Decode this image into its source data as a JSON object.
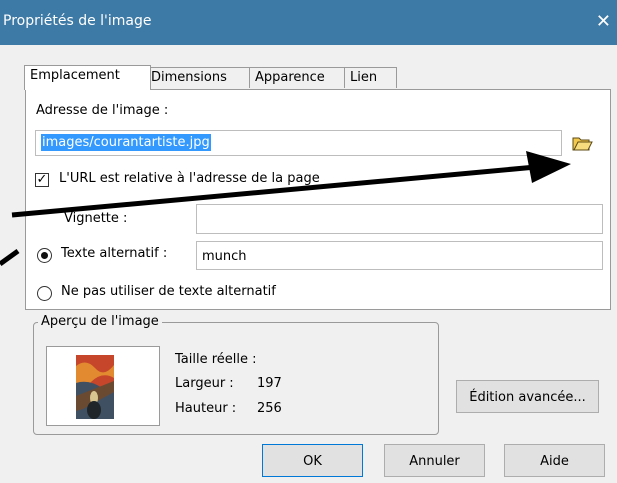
{
  "window": {
    "title": "Propriétés de l'image",
    "close_symbol": "✕"
  },
  "tabs": [
    {
      "label": "Emplacement",
      "active": true
    },
    {
      "label": "Dimensions",
      "active": false
    },
    {
      "label": "Apparence",
      "active": false
    },
    {
      "label": "Lien",
      "active": false
    }
  ],
  "location": {
    "label": "Adresse de l'image :",
    "value": "images/courantartiste.jpg",
    "relative_checkbox_label": "L'URL est relative à l'adresse de la page",
    "relative_checked": true
  },
  "thumbnail": {
    "label": "Vignette :",
    "value": ""
  },
  "alt_text": {
    "label": "Texte alternatif :",
    "value": "munch",
    "selected": true,
    "none_label": "Ne pas utiliser de texte alternatif",
    "none_selected": false
  },
  "preview": {
    "title": "Aperçu de l'image",
    "real_size_label": "Taille réelle :",
    "width_label": "Largeur :",
    "width_value": "197",
    "height_label": "Hauteur :",
    "height_value": "256"
  },
  "buttons": {
    "advanced": "Édition avancée...",
    "ok": "OK",
    "cancel": "Annuler",
    "help": "Aide"
  },
  "colors": {
    "titlebar": "#3d7aa6",
    "selection": "#3399ff",
    "dialog_bg": "#f0f0f0",
    "arrow": "#000000"
  }
}
